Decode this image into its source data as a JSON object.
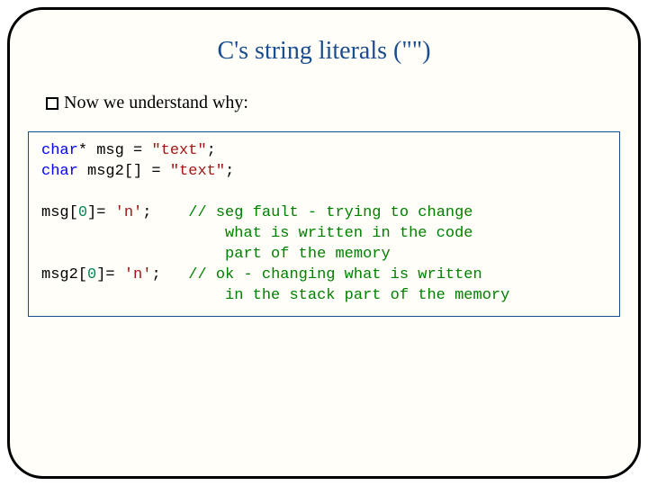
{
  "title": "C's  string literals (\"\")",
  "bullet": "Now we understand why:",
  "code": {
    "l1_kw": "char",
    "l1_rest": "* msg = ",
    "l1_str": "\"text\"",
    "l1_end": ";",
    "l2_kw": "char",
    "l2_rest": " msg2[] = ",
    "l2_str": "\"text\"",
    "l2_end": ";",
    "l3_a": "msg[",
    "l3_num": "0",
    "l3_b": "]= ",
    "l3_str": "'n'",
    "l3_c": ";    ",
    "l3_com": "// seg fault - trying to change",
    "l4_pad": "                    ",
    "l4_com": "what is written in the code",
    "l5_pad": "                    ",
    "l5_com": "part of the memory",
    "l6_a": "msg2[",
    "l6_num": "0",
    "l6_b": "]= ",
    "l6_str": "'n'",
    "l6_c": ";   ",
    "l6_com": "// ok - changing what is written",
    "l7_pad": "                    ",
    "l7_com": "in the stack part of the memory"
  }
}
